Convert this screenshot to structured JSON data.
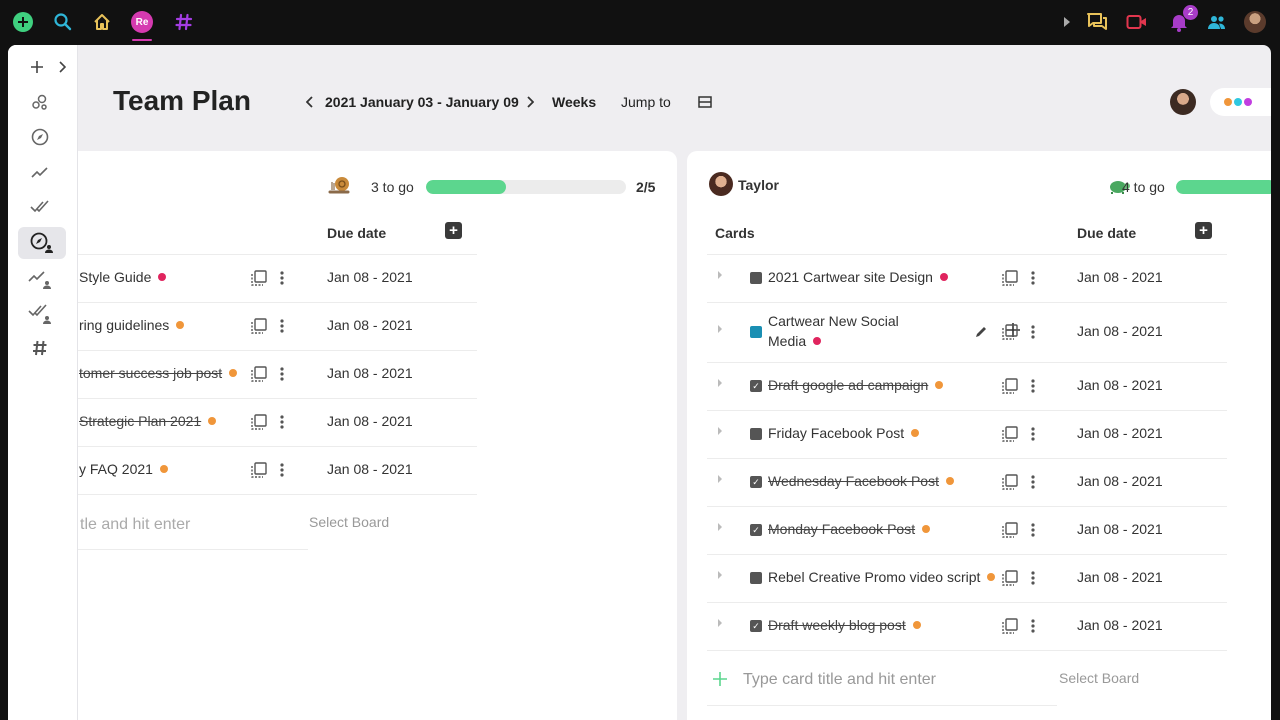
{
  "topbar": {
    "icons": [
      "add-circle-icon",
      "search-icon",
      "home-icon",
      "re-workspace-icon",
      "hashtag-icon",
      "caret-right-icon",
      "chat-icon",
      "video-icon",
      "bell-icon",
      "people-icon",
      "user-avatar"
    ],
    "workspace_badge": "Re",
    "notification_count": "2",
    "colors": {
      "add": "#3fd07f",
      "search": "#2fb6d8",
      "home": "#e8c25a",
      "workspace": "#d53ab0",
      "hashtag": "#a43de3",
      "chat": "#e8c25a",
      "video": "#e2364e",
      "bell": "#a83cc8",
      "people": "#2fb6d8"
    }
  },
  "sidebar": {
    "icons": [
      "plus-icon",
      "chevron-right-icon",
      "bubbles-icon",
      "compass-icon",
      "trend-icon",
      "double-check-icon",
      "compass-user-icon",
      "trend-user-icon",
      "double-check-user-icon",
      "hashtag-icon"
    ],
    "active": "compass-user-icon"
  },
  "header": {
    "title": "Team Plan",
    "date_range": "2021 January 03 - January 09",
    "view": "Weeks",
    "jump_to": "Jump to",
    "status_dot_colors": [
      "#f0963a",
      "#2fc8e0",
      "#c13ee0"
    ]
  },
  "left_board": {
    "remaining": "3 to go",
    "progress_text": "2/5",
    "progress_fraction": 0.4,
    "due_header": "Due date",
    "rows": [
      {
        "title": "Style Guide",
        "dot": "red",
        "done": false,
        "due": "Jan 08 - 2021"
      },
      {
        "title": "ring guidelines",
        "dot": "orange",
        "done": false,
        "due": "Jan 08 - 2021"
      },
      {
        "title": "tomer success job post",
        "dot": "orange",
        "done": true,
        "due": "Jan 08 - 2021"
      },
      {
        "title": " Strategic Plan 2021",
        "dot": "orange",
        "done": true,
        "due": "Jan 08 - 2021"
      },
      {
        "title": "y FAQ 2021",
        "dot": "orange",
        "done": false,
        "due": "Jan 08 - 2021"
      }
    ],
    "input_placeholder": "tle and hit enter",
    "select_board": "Select Board"
  },
  "right_board": {
    "owner": "Taylor",
    "remaining": "4 to go",
    "progress_fraction": 0.5,
    "cards_header": "Cards",
    "due_header": "Due date",
    "rows": [
      {
        "title": "2021 Cartwear site Design",
        "dot": "red",
        "done": false,
        "due": "Jan 08 - 2021"
      },
      {
        "title": "Cartwear New Social Media",
        "dot": "red",
        "done": false,
        "due": "Jan 08 - 2021"
      },
      {
        "title": "Draft google ad campaign",
        "dot": "orange",
        "done": true,
        "due": "Jan 08 - 2021"
      },
      {
        "title": "Friday Facebook Post",
        "dot": "orange",
        "done": false,
        "due": "Jan 08 - 2021"
      },
      {
        "title": "Wednesday Facebook Post",
        "dot": "orange",
        "done": true,
        "due": "Jan 08 - 2021"
      },
      {
        "title": "Monday Facebook Post",
        "dot": "orange",
        "done": true,
        "due": "Jan 08 - 2021"
      },
      {
        "title": "Rebel Creative Promo video script",
        "dot": "orange",
        "done": false,
        "due": "Jan 08 - 2021"
      },
      {
        "title": "Draft weekly blog post",
        "dot": "orange",
        "done": true,
        "due": "Jan 08 - 2021"
      }
    ],
    "input_placeholder": "Type card title and hit enter",
    "select_board": "Select Board"
  }
}
